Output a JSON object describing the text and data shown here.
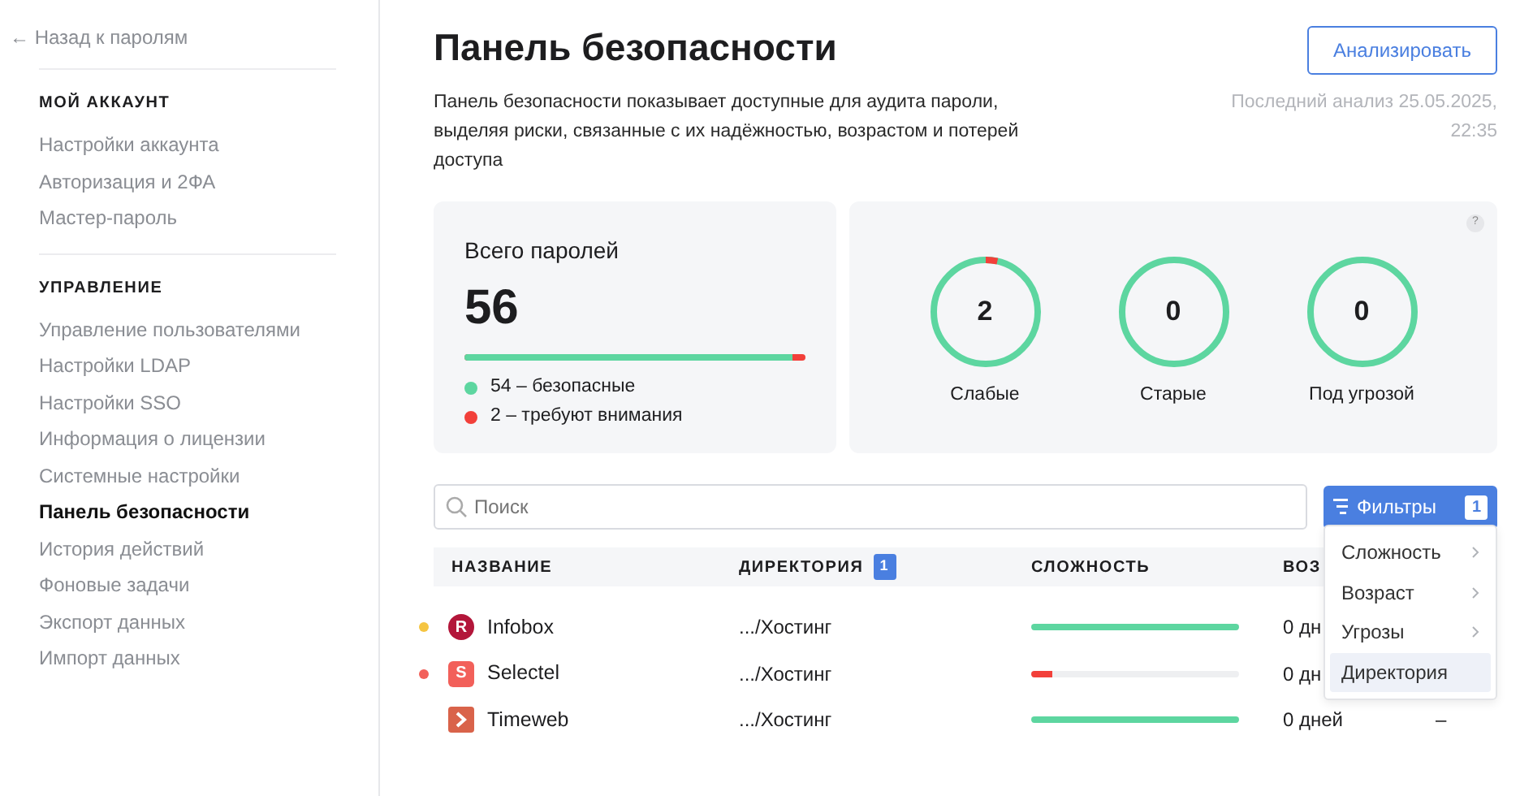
{
  "sidebar": {
    "back_link": "← Назад к паролям",
    "sections": [
      {
        "title": "МОЙ АККАУНТ",
        "items": [
          {
            "label": "Настройки аккаунта",
            "selected": false
          },
          {
            "label": "Авторизация и 2ФА",
            "selected": false
          },
          {
            "label": "Мастер-пароль",
            "selected": false
          }
        ]
      },
      {
        "title": "УПРАВЛЕНИЕ",
        "items": [
          {
            "label": "Управление пользователями",
            "selected": false
          },
          {
            "label": "Настройки LDAP",
            "selected": false
          },
          {
            "label": "Настройки SSO",
            "selected": false
          },
          {
            "label": "Информация о лицензии",
            "selected": false
          },
          {
            "label": "Системные настройки",
            "selected": false
          },
          {
            "label": "Панель безопасности",
            "selected": true
          },
          {
            "label": "История действий",
            "selected": false
          },
          {
            "label": "Фоновые задачи",
            "selected": false
          },
          {
            "label": "Экспорт данных",
            "selected": false
          },
          {
            "label": "Импорт данных",
            "selected": false
          }
        ]
      }
    ]
  },
  "header": {
    "title": "Панель безопасности",
    "button": "Анализировать",
    "description": "Панель безопасности показывает доступные для аудита пароли, выделяя риски, связанные с их надёжностью, возрастом и потерей доступа",
    "last_analysis": "Последний анализ 25.05.2025, 22:35"
  },
  "total": {
    "title": "Всего паролей",
    "count": "56",
    "level": 0.964,
    "legend": [
      {
        "text": "54 – безопасные",
        "color": "#5dd6a0"
      },
      {
        "text": "2 – требуют внимания",
        "color": "#f2403a"
      }
    ]
  },
  "help": "?",
  "rings": [
    {
      "value": "2",
      "label": "Слабые",
      "level": 0.036
    },
    {
      "value": "0",
      "label": "Старые",
      "level": 0
    },
    {
      "value": "0",
      "label": "Под угрозой",
      "level": 0
    }
  ],
  "search": {
    "placeholder": "Поиск"
  },
  "filters": {
    "label": "Фильтры",
    "count": "1"
  },
  "table": {
    "columns": [
      {
        "label": "НАЗВАНИЕ"
      },
      {
        "label": "ДИРЕКТОРИЯ",
        "badge": "1"
      },
      {
        "label": "СЛОЖНОСТЬ"
      },
      {
        "label": "ВОЗ"
      }
    ],
    "rows": [
      {
        "name": "Infobox",
        "logo": {
          "kind": "circle",
          "text": "R",
          "color": "#b3163a"
        },
        "color": "#f5c542",
        "directory": ".../Хостинг",
        "level": 1,
        "weak": false,
        "age": "0 дн"
      },
      {
        "name": "Selectel",
        "logo": {
          "kind": "square",
          "text": "S",
          "color": "#f2605a"
        },
        "color": "#f2605a",
        "directory": ".../Хостинг",
        "level": 0.1,
        "weak": true,
        "age": "0 дн"
      },
      {
        "name": "Timeweb",
        "logo": {
          "kind": "chevron",
          "color": "#d9634a"
        },
        "directory": ".../Хостинг",
        "level": 1,
        "weak": false,
        "age": "0 дней",
        "column_5": "–"
      }
    ]
  },
  "menu": [
    {
      "label": "Сложность",
      "submenu": true,
      "selected": false
    },
    {
      "label": "Возраст",
      "submenu": true,
      "selected": false
    },
    {
      "label": "Угрозы",
      "submenu": true,
      "selected": false
    },
    {
      "label": "Директория",
      "submenu": false,
      "selected": true
    }
  ]
}
